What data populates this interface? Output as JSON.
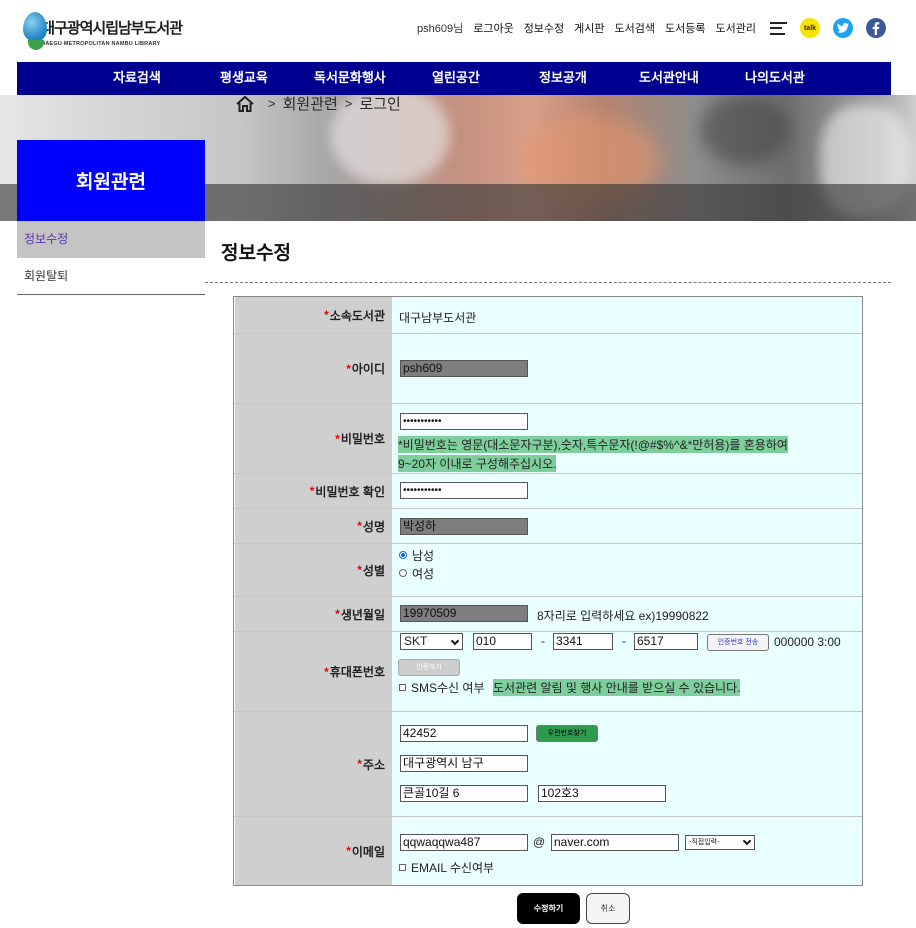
{
  "site": {
    "logo_title": "대구광역시립남부도서관",
    "logo_subtitle": "DAEGU METROPOLITAN NAMBU LIBRARY"
  },
  "top_links": {
    "user": "psh609님",
    "logout": "로그아웃",
    "edit_info": "정보수정",
    "board": "게시판",
    "book_search": "도서검색",
    "book_register": "도서등록",
    "book_manage": "도서관리",
    "kakao_label": "talk"
  },
  "gnb": [
    "자료검색",
    "평생교육",
    "독서문화행사",
    "열린공간",
    "정보공개",
    "도서관안내",
    "나의도서관"
  ],
  "breadcrumb": [
    "회원관련",
    "로그인"
  ],
  "sidebar": {
    "title": "회원관련",
    "items": [
      "정보수정",
      "회원탈퇴"
    ]
  },
  "page_title": "정보수정",
  "form": {
    "library": {
      "label": "소속도서관",
      "value": "대구남부도서관"
    },
    "user_id": {
      "label": "아이디",
      "value": "psh609"
    },
    "password": {
      "label": "비밀번호",
      "value": "•••••••••••",
      "hint_line1": "*비밀번호는 영문(대소문자구분),숫자,특수문자(!@#$%^&*만허용)를 혼용하여",
      "hint_line2": "9~20자 이내로 구성해주십시오."
    },
    "password_confirm": {
      "label": "비밀번호 확인",
      "value": "•••••••••••"
    },
    "name": {
      "label": "성명",
      "value": "박성하"
    },
    "gender": {
      "label": "성별",
      "male": "남성",
      "female": "여성",
      "selected": "남성"
    },
    "birth": {
      "label": "생년월일",
      "value": "19970509",
      "hint": "8자리로 입력하세요 ex)19990822"
    },
    "phone": {
      "label": "휴대폰번호",
      "carrier": "SKT",
      "part1": "010",
      "part2": "3341",
      "part3": "6517",
      "dash": "-",
      "send_code_button": "인증번호 전송",
      "code_timer": "000000 3:00",
      "verify_button": "인증하기",
      "sms_label": "SMS수신 여부",
      "sms_notice": "도서관련 알림 및 행사 안내를 받으실 수 있습니다."
    },
    "address": {
      "label": "주소",
      "zip": "42452",
      "zip_button": "우편번호찾기",
      "line1": "대구광역시 남구",
      "line2": "큰골10길 6",
      "line3": "102호3"
    },
    "email": {
      "label": "이메일",
      "local": "qqwaqqwa487",
      "at": "@",
      "domain": "naver.com",
      "domain_select": "-직접입력-",
      "email_label": "EMAIL 수신여부"
    },
    "required_mark": "*"
  },
  "actions": {
    "submit": "수정하기",
    "cancel": "취소"
  },
  "colors": {
    "gnb": "#000090",
    "sidebar_title": "#0000ff",
    "form_bg": "#eaffff",
    "highlight": "#7fcf9d"
  }
}
